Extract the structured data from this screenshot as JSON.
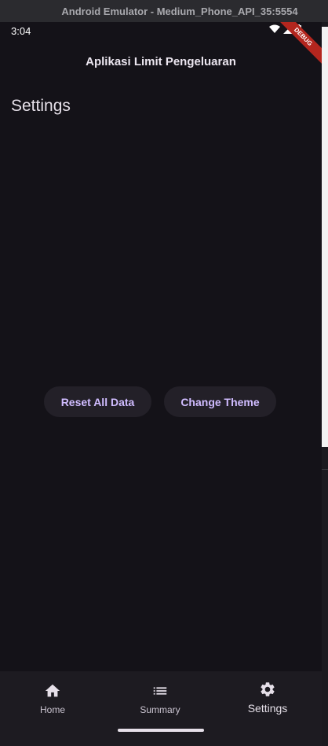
{
  "window": {
    "title": "Android Emulator - Medium_Phone_API_35:5554"
  },
  "status_bar": {
    "time": "3:04",
    "debug_label": "DEBUG"
  },
  "app_bar": {
    "title": "Aplikasi Limit Pengeluaran"
  },
  "page": {
    "heading": "Settings"
  },
  "actions": {
    "reset_label": "Reset All Data",
    "theme_label": "Change Theme"
  },
  "bottom_nav": {
    "items": [
      {
        "label": "Home",
        "icon": "home-icon"
      },
      {
        "label": "Summary",
        "icon": "list-icon"
      },
      {
        "label": "Settings",
        "icon": "gear-icon",
        "active": true
      }
    ]
  },
  "colors": {
    "background": "#141218",
    "button_bg": "#232028",
    "button_text": "#d0bcff",
    "debug_ribbon": "#b3261e"
  }
}
